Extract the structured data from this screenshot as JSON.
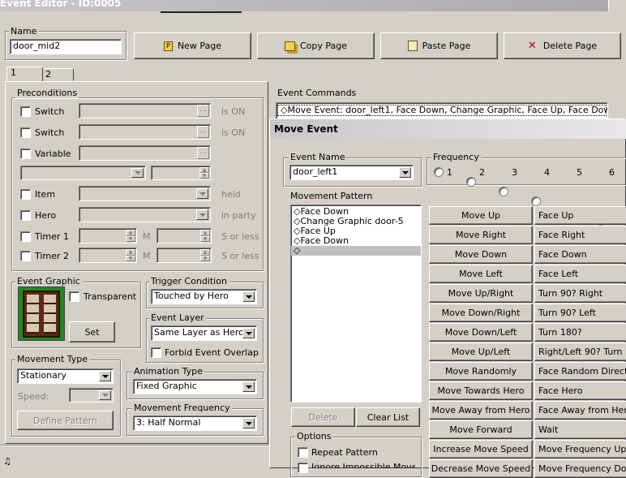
{
  "window": {
    "title": "Event Editor - ID:0005"
  },
  "name": {
    "label": "Name",
    "value": "door_mid2"
  },
  "toolbar": {
    "new_page": "New Page",
    "copy_page": "Copy Page",
    "paste_page": "Paste Page",
    "delete_page": "Delete Page"
  },
  "tabs": [
    "1",
    "2"
  ],
  "preconditions": {
    "label": "Preconditions",
    "switch1": "Switch",
    "switch1_suffix": "is ON",
    "switch2": "Switch",
    "switch2_suffix": "is ON",
    "variable": "Variable",
    "item": "Item",
    "item_suffix": "held",
    "hero": "Hero",
    "hero_suffix": "in party",
    "timer1": "Timer 1",
    "timer1_m": "M",
    "timer1_suffix": "S or less",
    "timer2": "Timer 2",
    "timer2_m": "M",
    "timer2_suffix": "S or less"
  },
  "event_graphic": {
    "label": "Event Graphic",
    "transparent": "Transparent",
    "set": "Set"
  },
  "trigger": {
    "label": "Trigger Condition",
    "value": "Touched by Hero"
  },
  "layer": {
    "label": "Event Layer",
    "value": "Same Layer as Hero",
    "forbid": "Forbid Event Overlap"
  },
  "movement_type": {
    "label": "Movement Type",
    "value": "Stationary",
    "speed": "Speed:",
    "define": "Define Pattern"
  },
  "animation": {
    "label": "Animation Type",
    "value": "Fixed Graphic"
  },
  "move_freq": {
    "label": "Movement Frequency",
    "value": "3: Half Normal"
  },
  "event_commands": {
    "label": "Event Commands",
    "first": "◇Move Event: door_left1, Face Down, Change Graphic, Face Up, Face Dowr"
  },
  "move_event": {
    "title": "Move Event",
    "event_name_label": "Event Name",
    "event_name": "door_left1",
    "frequency_label": "Frequency",
    "frequencies": [
      "1",
      "2",
      "3",
      "4",
      "5",
      "6"
    ],
    "pattern_label": "Movement Pattern",
    "pattern": [
      "◇Face Down",
      "◇Change Graphic door-5",
      "◇Face Up",
      "◇Face Down",
      "◇"
    ],
    "delete": "Delete",
    "clear": "Clear List",
    "options": "Options",
    "repeat": "Repeat Pattern",
    "ignore": "Ignore Impossible Moves",
    "col1": [
      "Move Up",
      "Move Right",
      "Move Down",
      "Move Left",
      "Move Up/Right",
      "Move Down/Right",
      "Move Down/Left",
      "Move Up/Left",
      "Move Randomly",
      "Move Towards Hero",
      "Move Away from Hero",
      "Move Forward",
      "Increase Move Speed",
      "Decrease Move Speed"
    ],
    "col2": [
      "Face Up",
      "Face Right",
      "Face Down",
      "Face Left",
      "Turn 90? Right",
      "Turn 90? Left",
      "Turn 180?",
      "Right/Left 90? Turn",
      "Face Random Direction",
      "Face Hero",
      "Face Away from Hero",
      "Wait",
      "Move Frequency Up",
      "Move Frequency Down"
    ]
  }
}
